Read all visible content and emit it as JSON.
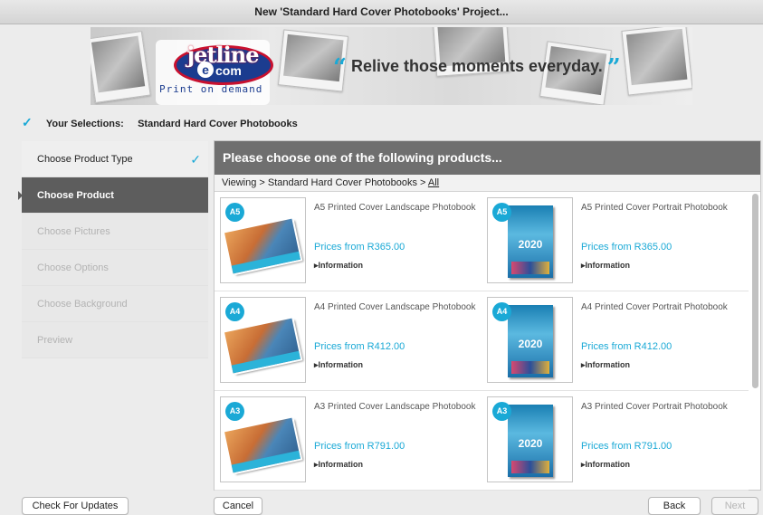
{
  "window": {
    "title": "New 'Standard Hard Cover Photobooks' Project..."
  },
  "banner": {
    "logo_text": "jetline",
    "logo_com": "com",
    "logo_e": "e",
    "logo_tagline": "Print on demand",
    "slogan": "Relive those moments everyday.",
    "quote_open": "“",
    "quote_close": "”"
  },
  "selections": {
    "label": "Your Selections:",
    "value": "Standard Hard Cover Photobooks"
  },
  "steps": [
    {
      "label": "Choose Product Type",
      "state": "done"
    },
    {
      "label": "Choose Product",
      "state": "active"
    },
    {
      "label": "Choose Pictures",
      "state": "pending"
    },
    {
      "label": "Choose Options",
      "state": "pending"
    },
    {
      "label": "Choose Background",
      "state": "pending"
    },
    {
      "label": "Preview",
      "state": "pending"
    }
  ],
  "main": {
    "header": "Please choose one of the following products...",
    "breadcrumb_prefix": "Viewing > Standard Hard Cover Photobooks > ",
    "breadcrumb_link": "All"
  },
  "products": [
    {
      "badge": "A5",
      "name": "A5 Printed Cover Landscape Photobook",
      "price": "Prices from R365.00",
      "info": "▸Information",
      "orientation": "landscape"
    },
    {
      "badge": "A5",
      "name": "A5 Printed Cover Portrait Photobook",
      "price": "Prices from R365.00",
      "info": "▸Information",
      "orientation": "portrait"
    },
    {
      "badge": "A4",
      "name": "A4 Printed Cover Landscape Photobook",
      "price": "Prices from R412.00",
      "info": "▸Information",
      "orientation": "landscape"
    },
    {
      "badge": "A4",
      "name": "A4 Printed Cover Portrait Photobook",
      "price": "Prices from R412.00",
      "info": "▸Information",
      "orientation": "portrait"
    },
    {
      "badge": "A3",
      "name": "A3 Printed Cover Landscape Photobook",
      "price": "Prices from R791.00",
      "info": "▸Information",
      "orientation": "landscape"
    },
    {
      "badge": "A3",
      "name": "A3 Printed Cover Portrait Photobook",
      "price": "Prices from R791.00",
      "info": "▸Information",
      "orientation": "portrait"
    }
  ],
  "buttons": {
    "check_updates": "Check For Updates",
    "cancel": "Cancel",
    "back": "Back",
    "next": "Next"
  },
  "colors": {
    "accent": "#1aa9d6",
    "header_gray": "#6f6f6f",
    "active_step": "#5d5d5d"
  },
  "icons": {
    "check": "checkmark-icon",
    "step_done": "checkmark-icon",
    "info": "triangle-right-icon"
  }
}
